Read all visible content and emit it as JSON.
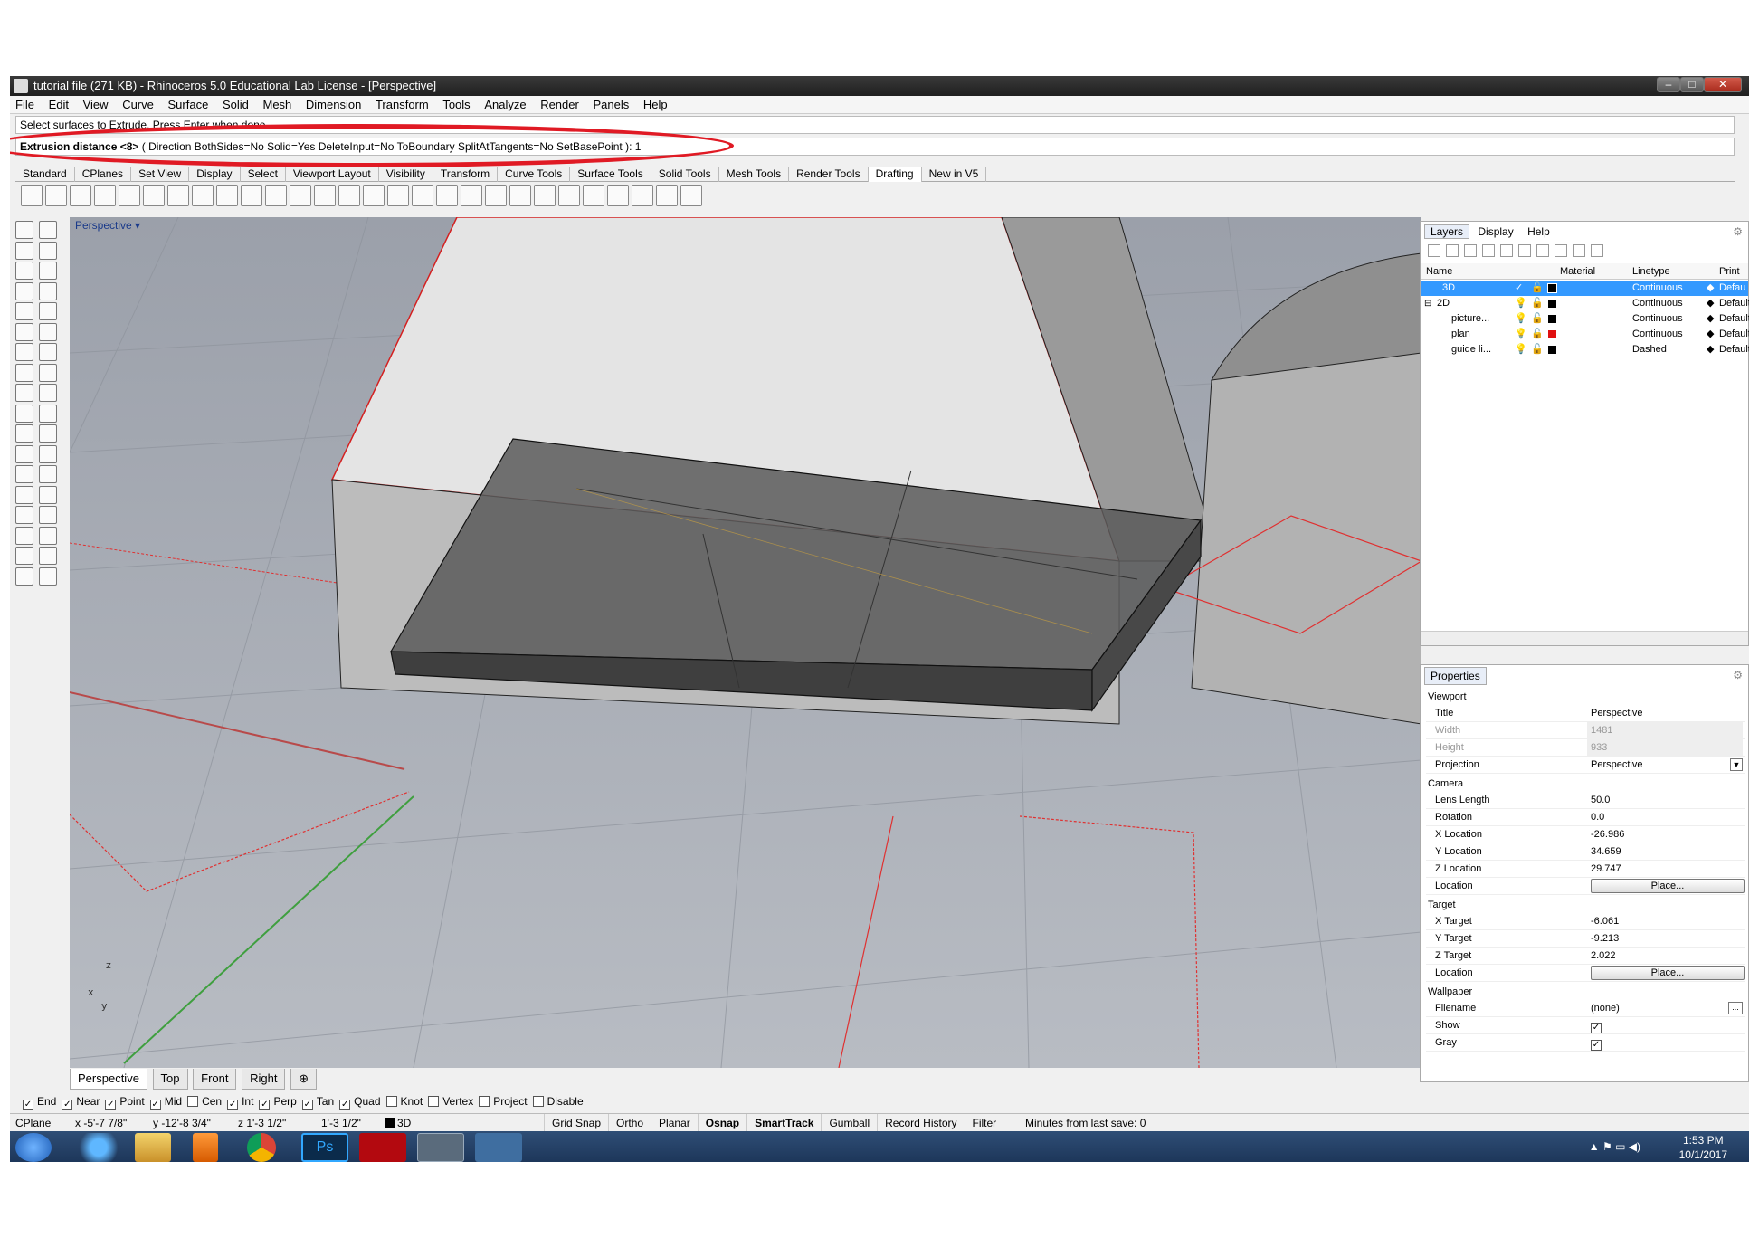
{
  "window": {
    "title": "tutorial file (271 KB) - Rhinoceros 5.0 Educational Lab License - [Perspective]"
  },
  "menu": [
    "File",
    "Edit",
    "View",
    "Curve",
    "Surface",
    "Solid",
    "Mesh",
    "Dimension",
    "Transform",
    "Tools",
    "Analyze",
    "Render",
    "Panels",
    "Help"
  ],
  "command": {
    "history": "Select surfaces to Extrude. Press Enter when done",
    "prompt": "Extrusion distance <8>",
    "options": "( Direction  BothSides=No  Solid=Yes  DeleteInput=No  ToBoundary  SplitAtTangents=No  SetBasePoint ):",
    "value": "1"
  },
  "toolbar_tabs": [
    "Standard",
    "CPlanes",
    "Set View",
    "Display",
    "Select",
    "Viewport Layout",
    "Visibility",
    "Transform",
    "Curve Tools",
    "Surface Tools",
    "Solid Tools",
    "Mesh Tools",
    "Render Tools",
    "Drafting",
    "New in V5"
  ],
  "active_tab": "Drafting",
  "viewport": {
    "label": "Perspective",
    "tabs": [
      "Perspective",
      "Top",
      "Front",
      "Right"
    ]
  },
  "layers_panel": {
    "tabs": [
      "Layers",
      "Display",
      "Help"
    ],
    "columns": [
      "Name",
      "Material",
      "Linetype",
      "Print W"
    ],
    "rows": [
      {
        "name": "3D",
        "linetype": "Continuous",
        "print": "Defau",
        "color": "#000000",
        "selected": true
      },
      {
        "name": "2D",
        "linetype": "Continuous",
        "print": "Default",
        "color": "#000000"
      },
      {
        "name": "picture...",
        "linetype": "Continuous",
        "print": "Default",
        "color": "#000000"
      },
      {
        "name": "plan",
        "linetype": "Continuous",
        "print": "Default",
        "color": "#e01010"
      },
      {
        "name": "guide li...",
        "linetype": "Dashed",
        "print": "Default",
        "color": "#000000"
      }
    ]
  },
  "properties": {
    "tab": "Properties",
    "sections": {
      "viewport": "Viewport",
      "camera": "Camera",
      "target": "Target",
      "wallpaper": "Wallpaper"
    },
    "title": {
      "k": "Title",
      "v": "Perspective"
    },
    "width": {
      "k": "Width",
      "v": "1481"
    },
    "height": {
      "k": "Height",
      "v": "933"
    },
    "projection": {
      "k": "Projection",
      "v": "Perspective"
    },
    "lens": {
      "k": "Lens Length",
      "v": "50.0"
    },
    "rotation": {
      "k": "Rotation",
      "v": "0.0"
    },
    "xloc": {
      "k": "X Location",
      "v": "-26.986"
    },
    "yloc": {
      "k": "Y Location",
      "v": "34.659"
    },
    "zloc": {
      "k": "Z Location",
      "v": "29.747"
    },
    "cloc": {
      "k": "Location",
      "v": "Place..."
    },
    "xt": {
      "k": "X Target",
      "v": "-6.061"
    },
    "yt": {
      "k": "Y Target",
      "v": "-9.213"
    },
    "zt": {
      "k": "Z Target",
      "v": "2.022"
    },
    "tloc": {
      "k": "Location",
      "v": "Place..."
    },
    "filename": {
      "k": "Filename",
      "v": "(none)"
    },
    "show": {
      "k": "Show"
    },
    "gray": {
      "k": "Gray"
    }
  },
  "osnap": [
    {
      "label": "End",
      "checked": true
    },
    {
      "label": "Near",
      "checked": true
    },
    {
      "label": "Point",
      "checked": true
    },
    {
      "label": "Mid",
      "checked": true
    },
    {
      "label": "Cen",
      "checked": false
    },
    {
      "label": "Int",
      "checked": true
    },
    {
      "label": "Perp",
      "checked": true
    },
    {
      "label": "Tan",
      "checked": true
    },
    {
      "label": "Quad",
      "checked": true
    },
    {
      "label": "Knot",
      "checked": false
    },
    {
      "label": "Vertex",
      "checked": false
    },
    {
      "label": "Project",
      "checked": false
    },
    {
      "label": "Disable",
      "checked": false
    }
  ],
  "status": {
    "cplane": "CPlane",
    "x": "x -5'-7 7/8\"",
    "y": "y -12'-8 3/4\"",
    "z": "z 1'-3 1/2\"",
    "dist": "1'-3 1/2\"",
    "layer": "3D",
    "toggles": [
      "Grid Snap",
      "Ortho",
      "Planar",
      "Osnap",
      "SmartTrack",
      "Gumball",
      "Record History",
      "Filter"
    ],
    "msg": "Minutes from last save: 0"
  },
  "clock": {
    "time": "1:53 PM",
    "date": "10/1/2017"
  }
}
